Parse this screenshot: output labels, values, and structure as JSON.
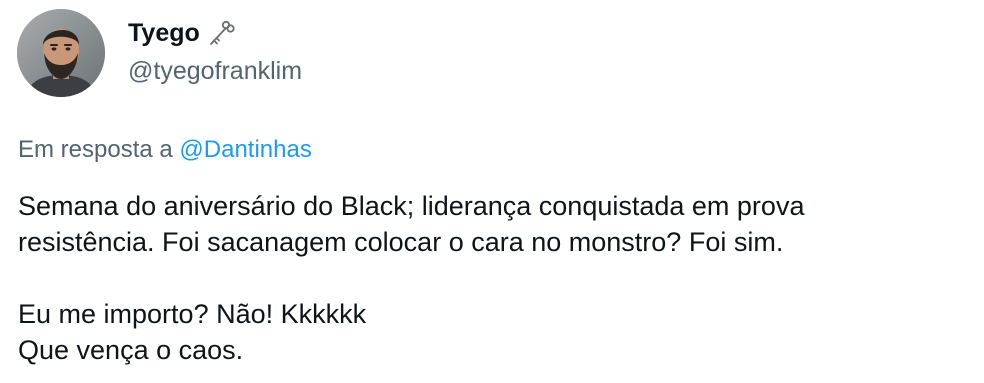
{
  "author": {
    "display_name": "Tyego",
    "handle": "@tyegofranklim",
    "badge_icon": "old-key-icon"
  },
  "reply": {
    "prefix": "Em resposta a",
    "mention": "@Dantinhas"
  },
  "tweet": {
    "line1": "Semana do aniversário do Black; liderança conquistada em prova",
    "line2": "resistência. Foi sacanagem colocar o cara no monstro? Foi sim.",
    "line3": "Eu me importo? Não! Kkkkkk",
    "line4": "Que vença o caos."
  },
  "colors": {
    "text_primary": "#0f1419",
    "text_secondary": "#536471",
    "link": "#1d9bf0"
  }
}
